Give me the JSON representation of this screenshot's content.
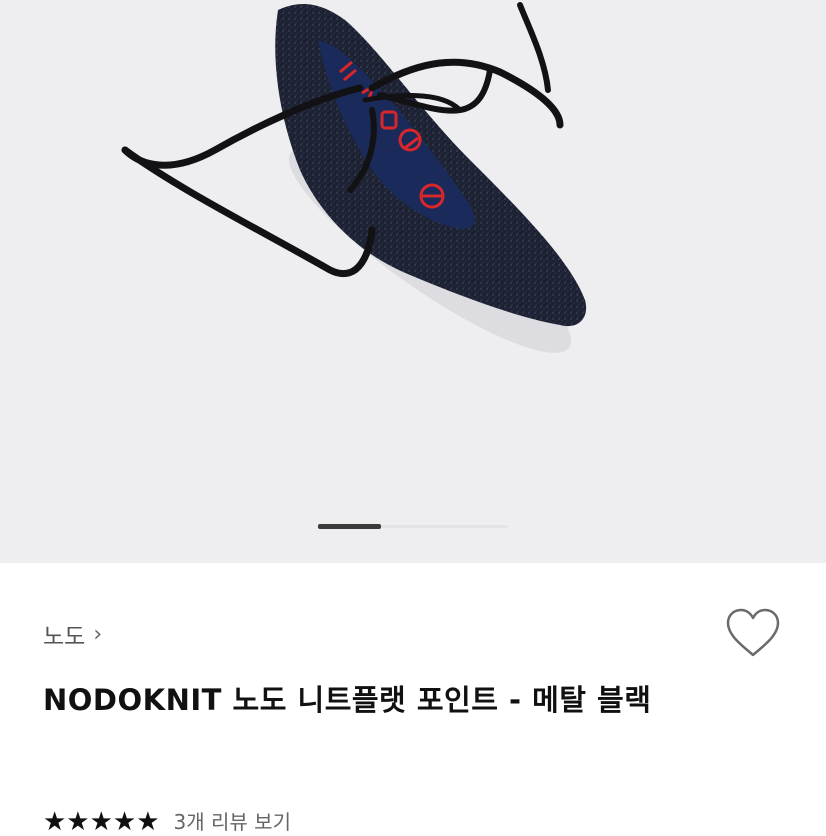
{
  "product": {
    "brand_link": "노도",
    "brand_chevron": "›",
    "title": "NODOKNIT 노도 니트플랫 포인트 - 메탈 블랙",
    "rating_stars": "★★★★★",
    "review_link": "3개 리뷰 보기"
  },
  "gallery": {
    "current_index": 1,
    "total": 3
  },
  "icons": {
    "wishlist": "heart-outline-icon",
    "chevron": "chevron-right-icon"
  },
  "colors": {
    "hero_bg": "#eeeef0",
    "shoe": "#1c2030",
    "logo_red": "#d8262a"
  }
}
